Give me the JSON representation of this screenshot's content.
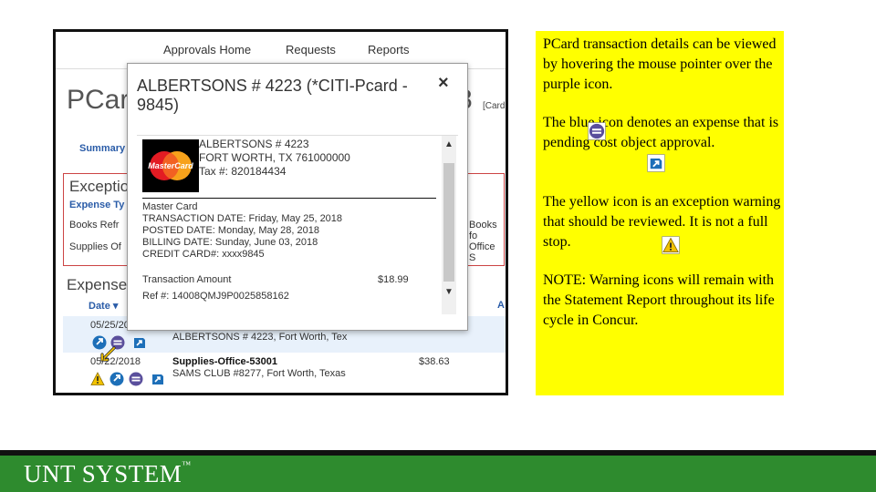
{
  "screenshot": {
    "nav": {
      "approvals_home": "Approvals Home",
      "requests": "Requests",
      "reports": "Reports"
    },
    "page_title": "PCar",
    "report_number_fragment": "8",
    "report_tag_fragment": "[Card",
    "summary_tab": "Summary",
    "exceptions": {
      "title": "Exceptio",
      "column": "Expense Ty",
      "row1_left": "Books Refr",
      "row2_left": "Supplies Of",
      "row1_right": "Books fo",
      "row2_right": "Office S"
    },
    "expenses": {
      "title": "Expense",
      "date_header": "Date ▾",
      "amount_header_fragment": "A",
      "rows": [
        {
          "date": "05/25/20",
          "merchant": "ALBERTSONS # 4223, Fort Worth, Tex"
        },
        {
          "date": "05/22/2018",
          "type": "Supplies-Office-53001",
          "merchant": "SAMS CLUB #8277, Fort Worth, Texas",
          "amount": "$38.63"
        }
      ]
    },
    "popup": {
      "title": "ALBERTSONS # 4223 (*CITI-Pcard - 9845)",
      "close": "×",
      "merchant_name": "ALBERTSONS # 4223",
      "merchant_city": "FORT WORTH, TX 761000000",
      "tax": "Tax #: 820184434",
      "card_logo": "MasterCard",
      "card_type": "Master Card",
      "transaction_date": "TRANSACTION DATE: Friday, May 25, 2018",
      "posted_date": "POSTED DATE: Monday, May 28, 2018",
      "billing_date": "BILLING DATE: Sunday, June 03, 2018",
      "credit_card": "CREDIT CARD#: xxxx9845",
      "amount_label": "Transaction Amount",
      "amount_value": "$18.99",
      "ref": "Ref #: 14008QMJ9P0025858162"
    }
  },
  "note": {
    "p1": "PCard transaction details can be viewed by hovering the mouse pointer over the purple       icon.",
    "p2": "The blue icon       denotes an expense that is pending cost object approval.",
    "p3": "The yellow icon       is an exception warning that should be reviewed.   It is not a full stop.",
    "p4": "NOTE: Warning icons will remain with the Statement Report throughout its life cycle in Concur."
  },
  "footer": {
    "logo": "UNT SYSTEM",
    "tm": "™"
  },
  "colors": {
    "note_bg": "#ffff00",
    "footer_green": "#2e8b2e",
    "link_blue": "#2a5ca8",
    "exception_red": "#cc4444",
    "icon_purple": "#5a4f9c",
    "icon_blue": "#1d6fb8",
    "icon_yellow": "#f2c200"
  }
}
